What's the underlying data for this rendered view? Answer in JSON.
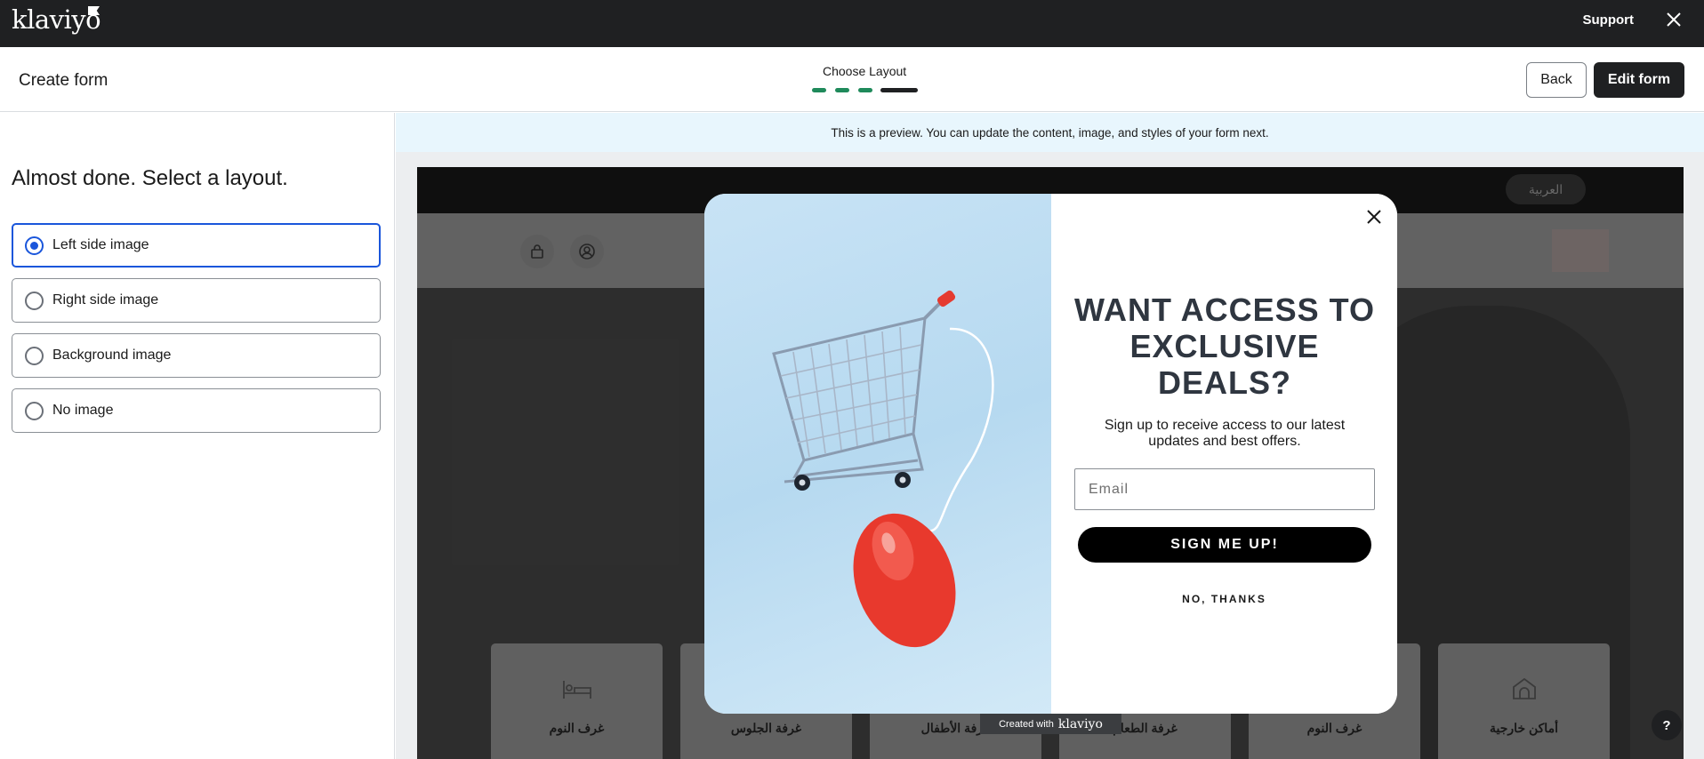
{
  "app": {
    "logo_text": "klaviyo",
    "support_label": "Support"
  },
  "header": {
    "title": "Create form",
    "step_label": "Choose Layout",
    "steps_total": 4,
    "steps_complete": 3,
    "back_label": "Back",
    "edit_label": "Edit form"
  },
  "sidebar": {
    "heading": "Almost done. Select a layout.",
    "options": [
      {
        "label": "Left side image",
        "selected": true
      },
      {
        "label": "Right side image",
        "selected": false
      },
      {
        "label": "Background image",
        "selected": false
      },
      {
        "label": "No image",
        "selected": false
      }
    ]
  },
  "preview": {
    "banner": "This is a preview. You can update the content, image, and styles of your form next.",
    "site": {
      "language": "العربية",
      "categories": [
        "غرف النوم",
        "غرفة الجلوس",
        "غرفة الأطفال",
        "غرفة الطعام",
        "غرف النوم",
        "أماكن خارجية"
      ]
    },
    "form": {
      "headline": "WANT ACCESS TO EXCLUSIVE DEALS?",
      "subtext": "Sign up to receive access to our latest updates and best offers.",
      "email_placeholder": "Email",
      "submit_label": "SIGN ME UP!",
      "decline_label": "NO, THANKS"
    },
    "badge": {
      "prefix": "Created with",
      "logo": "klaviyo"
    }
  },
  "help": {
    "label": "?"
  },
  "colors": {
    "accent_blue": "#1a56db",
    "step_green": "#1f8a5b",
    "dark": "#1f2022"
  }
}
